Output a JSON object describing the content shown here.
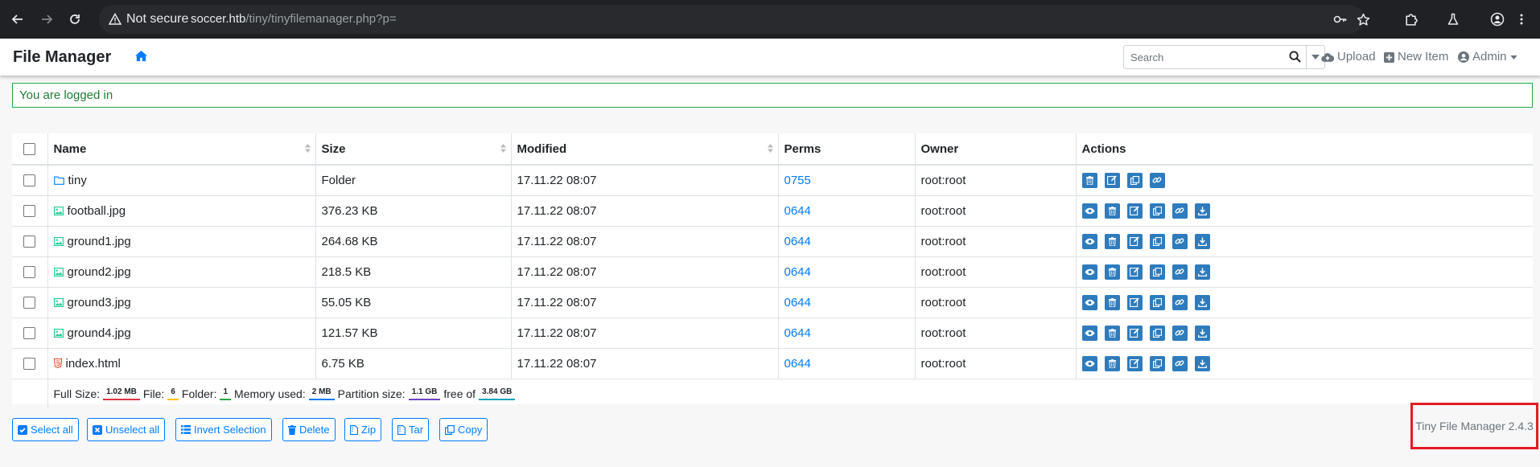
{
  "browser": {
    "security_label": "Not secure",
    "url_host": "soccer.htb",
    "url_path": "/tiny/tinyfilemanager.php?p="
  },
  "app": {
    "brand": "File Manager",
    "search_placeholder": "Search",
    "upload_label": "Upload",
    "new_item_label": "New Item",
    "admin_label": "Admin"
  },
  "alert": {
    "message": "You are logged in"
  },
  "table": {
    "headers": {
      "name": "Name",
      "size": "Size",
      "modified": "Modified",
      "perms": "Perms",
      "owner": "Owner",
      "actions": "Actions"
    },
    "rows": [
      {
        "name": "tiny",
        "type": "folder",
        "size": "Folder",
        "modified": "17.11.22 08:07",
        "perms": "0755",
        "owner": "root:root"
      },
      {
        "name": "football.jpg",
        "type": "image",
        "size": "376.23 KB",
        "modified": "17.11.22 08:07",
        "perms": "0644",
        "owner": "root:root"
      },
      {
        "name": "ground1.jpg",
        "type": "image",
        "size": "264.68 KB",
        "modified": "17.11.22 08:07",
        "perms": "0644",
        "owner": "root:root"
      },
      {
        "name": "ground2.jpg",
        "type": "image",
        "size": "218.5 KB",
        "modified": "17.11.22 08:07",
        "perms": "0644",
        "owner": "root:root"
      },
      {
        "name": "ground3.jpg",
        "type": "image",
        "size": "55.05 KB",
        "modified": "17.11.22 08:07",
        "perms": "0644",
        "owner": "root:root"
      },
      {
        "name": "ground4.jpg",
        "type": "image",
        "size": "121.57 KB",
        "modified": "17.11.22 08:07",
        "perms": "0644",
        "owner": "root:root"
      },
      {
        "name": "index.html",
        "type": "html",
        "size": "6.75 KB",
        "modified": "17.11.22 08:07",
        "perms": "0644",
        "owner": "root:root"
      }
    ],
    "summary": {
      "full_size_label": "Full Size:",
      "full_size": "1.02 MB",
      "file_label": "File:",
      "file_count": "6",
      "folder_label": "Folder:",
      "folder_count": "1",
      "memory_label": "Memory used:",
      "memory": "2 MB",
      "partition_label": "Partition size:",
      "partition": "1.1 GB",
      "free_label": "free of",
      "free": "3.84 GB"
    }
  },
  "bottom_buttons": {
    "select_all": "Select all",
    "unselect_all": "Unselect all",
    "invert_selection": "Invert Selection",
    "delete": "Delete",
    "zip": "Zip",
    "tar": "Tar",
    "copy": "Copy"
  },
  "version": "Tiny File Manager 2.4.3",
  "colors": {
    "accent": "#007bff",
    "action_button": "#2e7bbd",
    "alert_border": "#28a745",
    "highlight_box": "#e31b23",
    "badge_full_size": "#dc3545",
    "badge_file": "#ffc107",
    "badge_folder": "#28a745",
    "badge_memory": "#007bff",
    "badge_partition": "#6f42c1",
    "badge_free": "#17a2b8"
  }
}
